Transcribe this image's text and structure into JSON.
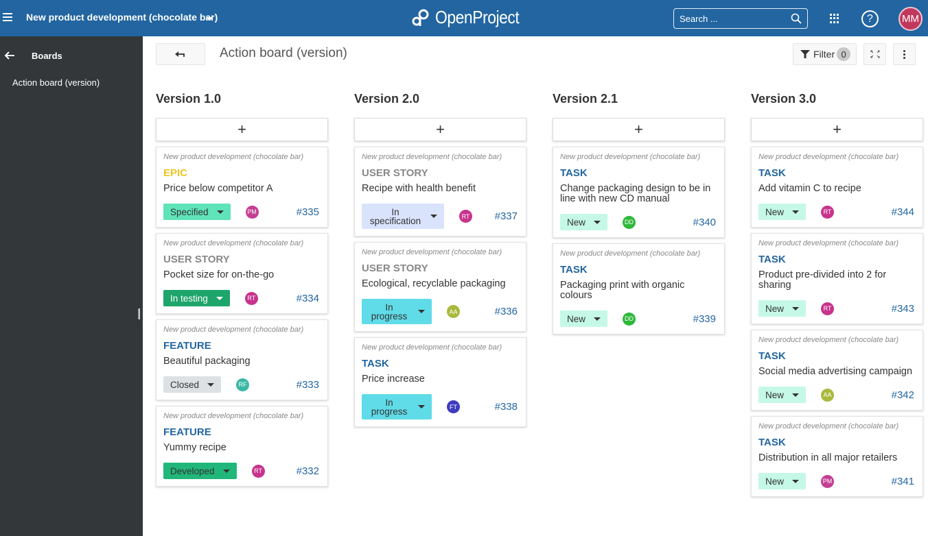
{
  "header": {
    "project": "New product development (chocolate bar)",
    "logo": "OpenProject",
    "search_placeholder": "Search ...",
    "help_label": "?",
    "user_initials": "MM",
    "brand_color": "#2265a0"
  },
  "sidebar": {
    "back_icon": "arrow-left-icon",
    "heading": "Boards",
    "items": [
      {
        "label": "Action board (version)"
      }
    ]
  },
  "toolbar": {
    "title": "Action board (version)",
    "filter_label": "Filter",
    "filter_count": "0"
  },
  "board": {
    "add_label": "+",
    "columns": [
      {
        "title": "Version 1.0",
        "cards": [
          {
            "project": "New product development (chocolate bar)",
            "type": "EPIC",
            "type_color": "#f0c520",
            "subject": "Price below competitor A",
            "status": "Specified",
            "status_color": "#5fe3b8",
            "assignee": "PM",
            "assignee_color": "#c43e93",
            "id": "#335"
          },
          {
            "project": "New product development (chocolate bar)",
            "type": "USER STORY",
            "type_color": "#888888",
            "subject": "Pocket size for on-the-go",
            "status": "In testing",
            "status_color": "#1ea56b",
            "status_text_color": "#ffffff",
            "assignee": "RT",
            "assignee_color": "#c8338c",
            "id": "#334"
          },
          {
            "project": "New product development (chocolate bar)",
            "type": "FEATURE",
            "type_color": "#2265a0",
            "subject": "Beautiful packaging",
            "status": "Closed",
            "status_color": "#dde1e4",
            "assignee": "RF",
            "assignee_color": "#3ab8a6",
            "id": "#333"
          },
          {
            "project": "New product development (chocolate bar)",
            "type": "FEATURE",
            "type_color": "#2265a0",
            "subject": "Yummy recipe",
            "status": "Developed",
            "status_color": "#21b77a",
            "assignee": "RT",
            "assignee_color": "#c8338c",
            "id": "#332"
          }
        ]
      },
      {
        "title": "Version 2.0",
        "cards": [
          {
            "project": "New product development (chocolate bar)",
            "type": "USER STORY",
            "type_color": "#888888",
            "subject": "Recipe with health benefit",
            "status": "In specification",
            "status_color": "#d9e3fc",
            "assignee": "RT",
            "assignee_color": "#c8338c",
            "id": "#337"
          },
          {
            "project": "New product development (chocolate bar)",
            "type": "USER STORY",
            "type_color": "#888888",
            "subject": "Ecological, recyclable packaging",
            "status": "In progress",
            "status_color": "#60dbe8",
            "assignee": "AA",
            "assignee_color": "#a9b93a",
            "id": "#336"
          },
          {
            "project": "New product development (chocolate bar)",
            "type": "TASK",
            "type_color": "#2265a0",
            "subject": "Price increase",
            "status": "In progress",
            "status_color": "#60dbe8",
            "assignee": "FT",
            "assignee_color": "#3f3bbf",
            "id": "#338"
          }
        ]
      },
      {
        "title": "Version 2.1",
        "cards": [
          {
            "project": "New product development (chocolate bar)",
            "type": "TASK",
            "type_color": "#2265a0",
            "subject": "Change packaging design to be in line with new CD manual",
            "status": "New",
            "status_color": "#c5f8e7",
            "assignee": "DD",
            "assignee_color": "#2eb83a",
            "id": "#340"
          },
          {
            "project": "New product development (chocolate bar)",
            "type": "TASK",
            "type_color": "#2265a0",
            "subject": "Packaging print with organic colours",
            "status": "New",
            "status_color": "#c5f8e7",
            "assignee": "DD",
            "assignee_color": "#2eb83a",
            "id": "#339"
          }
        ]
      },
      {
        "title": "Version 3.0",
        "cards": [
          {
            "project": "New product development (chocolate bar)",
            "type": "TASK",
            "type_color": "#2265a0",
            "subject": "Add vitamin C to recipe",
            "status": "New",
            "status_color": "#c5f8e7",
            "assignee": "RT",
            "assignee_color": "#c8338c",
            "id": "#344"
          },
          {
            "project": "New product development (chocolate bar)",
            "type": "TASK",
            "type_color": "#2265a0",
            "subject": "Product pre-divided into 2 for sharing",
            "status": "New",
            "status_color": "#c5f8e7",
            "assignee": "RT",
            "assignee_color": "#c8338c",
            "id": "#343"
          },
          {
            "project": "New product development (chocolate bar)",
            "type": "TASK",
            "type_color": "#2265a0",
            "subject": "Social media advertising campaign",
            "status": "New",
            "status_color": "#c5f8e7",
            "assignee": "AA",
            "assignee_color": "#a9b93a",
            "id": "#342"
          },
          {
            "project": "New product development (chocolate bar)",
            "type": "TASK",
            "type_color": "#2265a0",
            "subject": "Distribution in all major retailers",
            "status": "New",
            "status_color": "#c5f8e7",
            "assignee": "PM",
            "assignee_color": "#c43e93",
            "id": "#341"
          }
        ]
      }
    ]
  }
}
